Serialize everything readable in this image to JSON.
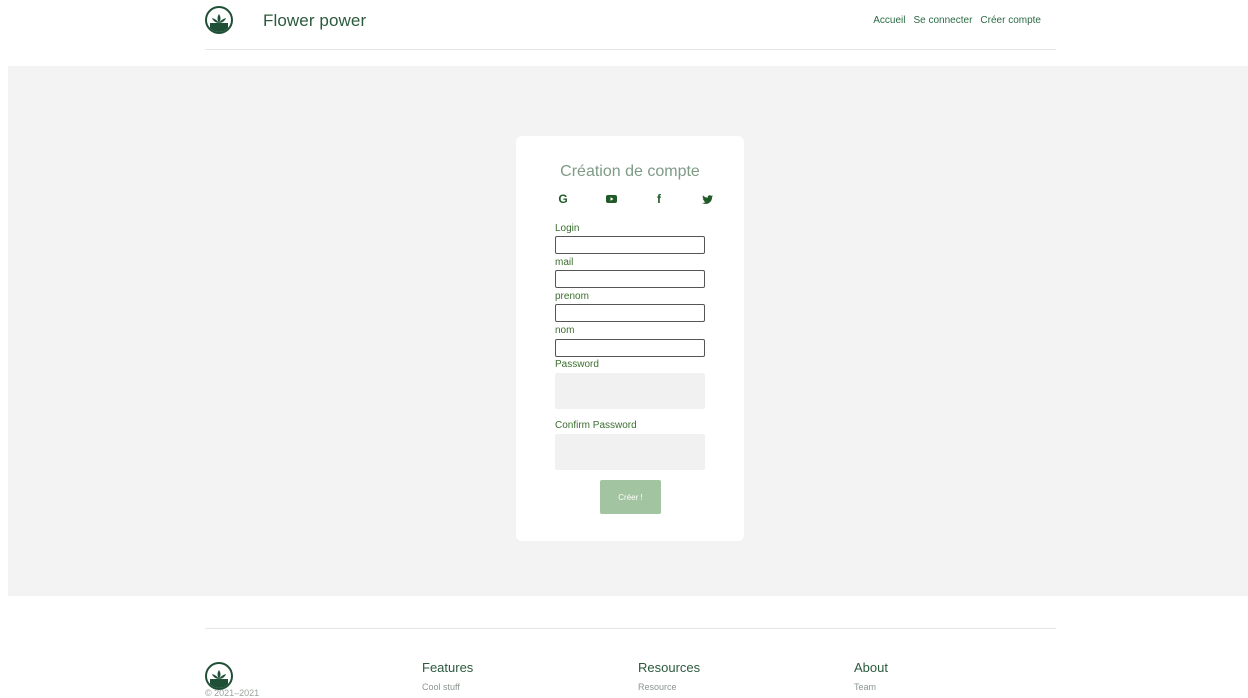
{
  "header": {
    "brand": "Flower power",
    "nav": [
      "Accueil",
      "Se connecter",
      "Créer compte"
    ]
  },
  "form": {
    "title": "Création de compte",
    "socials": [
      "google-icon",
      "youtube-icon",
      "facebook-icon",
      "twitter-icon"
    ],
    "fields": {
      "login_label": "Login",
      "mail_label": "mail",
      "prenom_label": "prenom",
      "nom_label": "nom",
      "password_label": "Password",
      "confirm_label": "Confirm Password"
    },
    "submit": "Créer !"
  },
  "footer": {
    "copyright": "© 2021–2021",
    "columns": [
      {
        "title": "Features",
        "first": "Cool stuff"
      },
      {
        "title": "Resources",
        "first": "Resource"
      },
      {
        "title": "About",
        "first": "Team"
      }
    ]
  },
  "colors": {
    "accent": "#2b5a3d",
    "button": "#a3c4a0",
    "band": "#f3f3f3"
  }
}
